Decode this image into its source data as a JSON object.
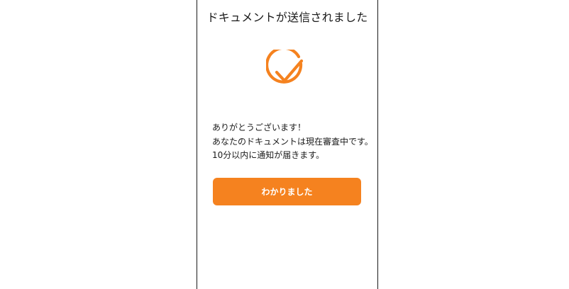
{
  "colors": {
    "accent": "#f5821f",
    "text": "#1a1a1a",
    "background": "#ffffff"
  },
  "dialog": {
    "title": "ドキュメントが送信されました",
    "icon": "check-circle-icon",
    "message_lines": [
      "ありがとうございます！",
      "あなたのドキュメントは現在審査中です。",
      "10分以内に通知が届きます。"
    ],
    "button_label": "わかりました"
  }
}
